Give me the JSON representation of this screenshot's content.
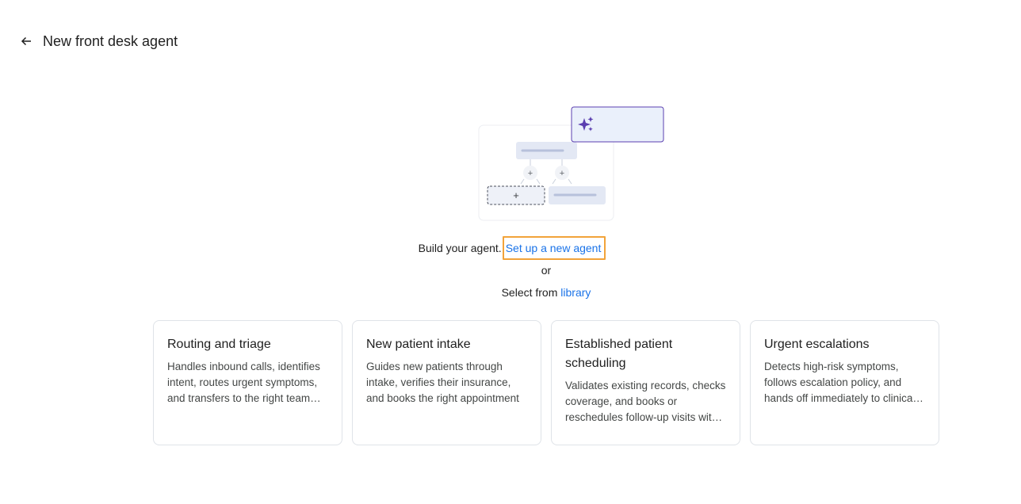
{
  "header": {
    "back_icon": "arrow-left-icon",
    "title": "New front desk agent"
  },
  "illustration": {
    "sparkle_icon": "sparkle-icon",
    "accent_color": "#5b3fb0",
    "plus": "+"
  },
  "build": {
    "prefix": "Build your agent.",
    "setup_link": "Set up a new agent",
    "or": "or",
    "select_prefix": "Select from",
    "library_link": "library"
  },
  "cards": [
    {
      "title": "Routing and triage",
      "description": "Handles inbound calls, identifies intent, routes urgent symptoms, and transfers to the right team with context."
    },
    {
      "title": "New patient intake",
      "description": "Guides new patients through intake, verifies their insurance, and books the right appointment"
    },
    {
      "title": "Established patient scheduling",
      "description": "Validates existing records, checks coverage, and books or reschedules follow-up visits with the right provider."
    },
    {
      "title": "Urgent escalations",
      "description": "Detects high-risk symptoms, follows escalation policy, and hands off immediately to clinical staff."
    }
  ],
  "colors": {
    "link": "#1a73e8",
    "highlight": "#f2a33a",
    "card_border": "#dfe3e8"
  }
}
